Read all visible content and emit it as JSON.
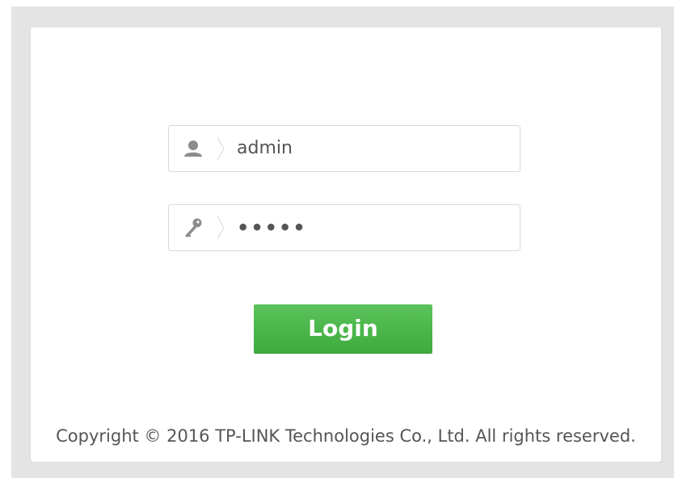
{
  "login_form": {
    "username": {
      "value": "admin",
      "icon": "user-icon"
    },
    "password": {
      "value": "•••••",
      "icon": "key-icon"
    },
    "login_label": "Login"
  },
  "footer": {
    "copyright": "Copyright © 2016 TP-LINK Technologies Co., Ltd. All rights reserved."
  },
  "colors": {
    "button_green": "#4cb84c",
    "backdrop_gray": "#e4e4e4",
    "text_gray": "#555555"
  }
}
